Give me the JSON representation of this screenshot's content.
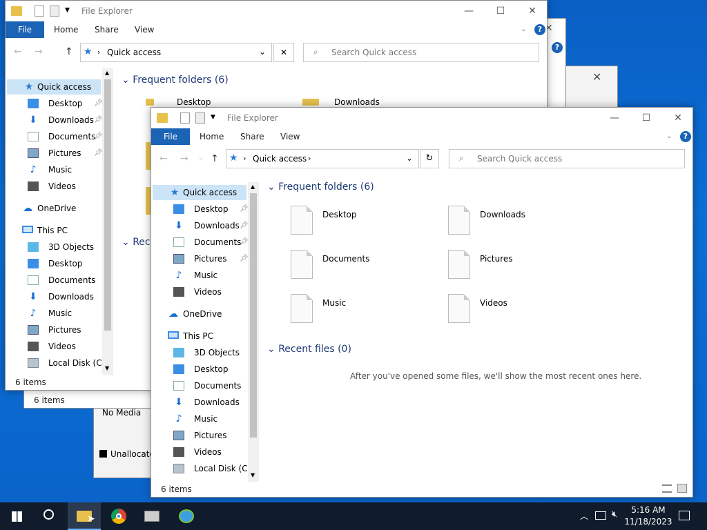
{
  "window_title": "File Explorer",
  "ribbon": {
    "file": "File",
    "home": "Home",
    "share": "Share",
    "view": "View"
  },
  "address": {
    "location": "Quick access"
  },
  "search": {
    "placeholder": "Search Quick access"
  },
  "nav": {
    "quick_access": "Quick access",
    "qa_items": [
      "Desktop",
      "Downloads",
      "Documents",
      "Pictures",
      "Music",
      "Videos"
    ],
    "onedrive": "OneDrive",
    "this_pc": "This PC",
    "pc_items": [
      "3D Objects",
      "Desktop",
      "Documents",
      "Downloads",
      "Music",
      "Pictures",
      "Videos",
      "Local Disk (C:)"
    ],
    "back_pc_items": [
      "3D Objects",
      "Desktop",
      "Documents",
      "Downloads",
      "Music",
      "Pictures",
      "Videos",
      "Local Disk (C:)"
    ]
  },
  "main": {
    "frequent_header": "Frequent folders (6)",
    "folders": [
      "Desktop",
      "Downloads",
      "Documents",
      "Pictures",
      "Music",
      "Videos"
    ],
    "recent_header": "Recent files (0)",
    "recent_header_truncated": "Rece",
    "recent_empty": "After you've opened some files, we'll show the most recent ones here."
  },
  "status": {
    "count": "6 items"
  },
  "behind": {
    "no_media": "No Media",
    "unallocated": "Unallocated"
  },
  "taskbar": {
    "time": "5:16 AM",
    "date": "11/18/2023"
  },
  "colors": {
    "accent": "#1a63b5",
    "selection": "#cce4f7",
    "taskbar": "#101c2c"
  }
}
